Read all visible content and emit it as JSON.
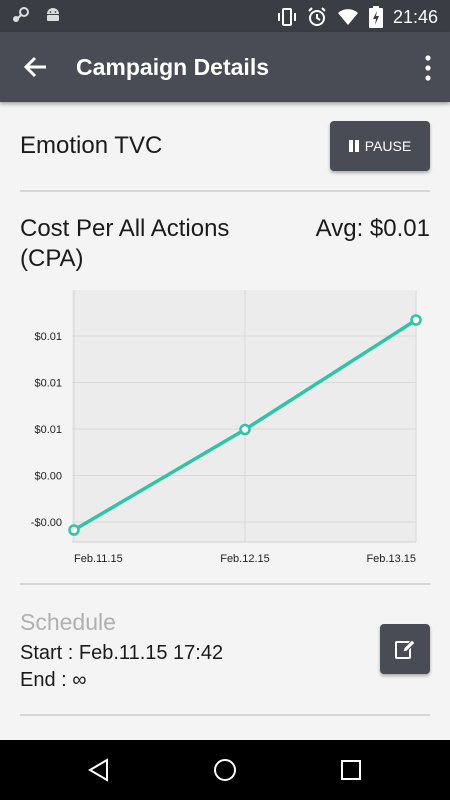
{
  "status_bar": {
    "time": "21:46",
    "icons": [
      "steam-icon",
      "android-icon",
      "vibrate-icon",
      "alarm-icon",
      "wifi-icon",
      "battery-charging-icon"
    ]
  },
  "app_bar": {
    "title": "Campaign Details",
    "back_icon": "arrow-back-icon",
    "menu_icon": "more-vert-icon"
  },
  "campaign": {
    "name": "Emotion TVC",
    "pause_label": "PAUSE"
  },
  "metric": {
    "title": "Cost Per All Actions (CPA)",
    "avg": "Avg: $0.01"
  },
  "chart_data": {
    "type": "line",
    "x": [
      "Feb.11.15",
      "Feb.12.15",
      "Feb.13.15"
    ],
    "y_tick_labels": [
      "$0.01",
      "$0.01",
      "$0.01",
      "$0.00",
      "-$0.00"
    ],
    "series": [
      {
        "values": [
          -0.0005,
          0.0062,
          0.0135
        ]
      }
    ],
    "ylim": [
      -0.0013,
      0.0155
    ],
    "grid": true,
    "line_color": "#2ec4a6"
  },
  "schedule": {
    "label": "Schedule",
    "start": "Start : Feb.11.15 17:42",
    "end": "End : ∞"
  },
  "nav": {
    "icons": [
      "back-nav-icon",
      "home-nav-icon",
      "recents-nav-icon"
    ]
  },
  "colors": {
    "app_bar": "#4a4c55",
    "status_bar": "#3b3d45",
    "accent": "#2ec4a6"
  }
}
